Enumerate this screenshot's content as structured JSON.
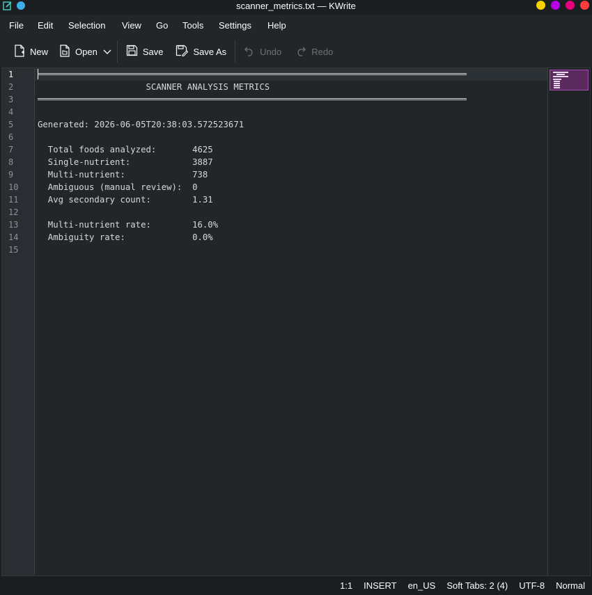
{
  "window": {
    "title": "scanner_metrics.txt — KWrite",
    "buttons": [
      {
        "name": "keep-above-button",
        "color": "#f6d100"
      },
      {
        "name": "minimize-button",
        "color": "#b600e8"
      },
      {
        "name": "maximize-button",
        "color": "#e6007e"
      },
      {
        "name": "close-button",
        "color": "#ff3b3b"
      }
    ]
  },
  "menu": [
    "File",
    "Edit",
    "Selection",
    "View",
    "Go",
    "Tools",
    "Settings",
    "Help"
  ],
  "toolbar": {
    "new_label": "New",
    "open_label": "Open",
    "save_label": "Save",
    "save_as_label": "Save As",
    "undo_label": "Undo",
    "redo_label": "Redo"
  },
  "editor": {
    "current_line": 1,
    "line_numbers": [
      "1",
      "2",
      "3",
      "4",
      "5",
      "6",
      "7",
      "8",
      "9",
      "10",
      "11",
      "12",
      "13",
      "14",
      "15"
    ],
    "lines": [
      "",
      "                     SCANNER ANALYSIS METRICS",
      "",
      "",
      "Generated: 2026-06-05T20:38:03.572523671",
      "",
      "  Total foods analyzed:       4625",
      "  Single-nutrient:            3887",
      "  Multi-nutrient:             738",
      "  Ambiguous (manual review):  0",
      "  Avg secondary count:        1.31",
      "",
      "  Multi-nutrient rate:        16.0%",
      "  Ambiguity rate:             0.0%",
      ""
    ]
  },
  "status": {
    "position": "1:1",
    "mode": "INSERT",
    "language": "en_US",
    "indent": "Soft Tabs: 2 (4)",
    "encoding": "UTF-8",
    "highlight": "Normal"
  }
}
